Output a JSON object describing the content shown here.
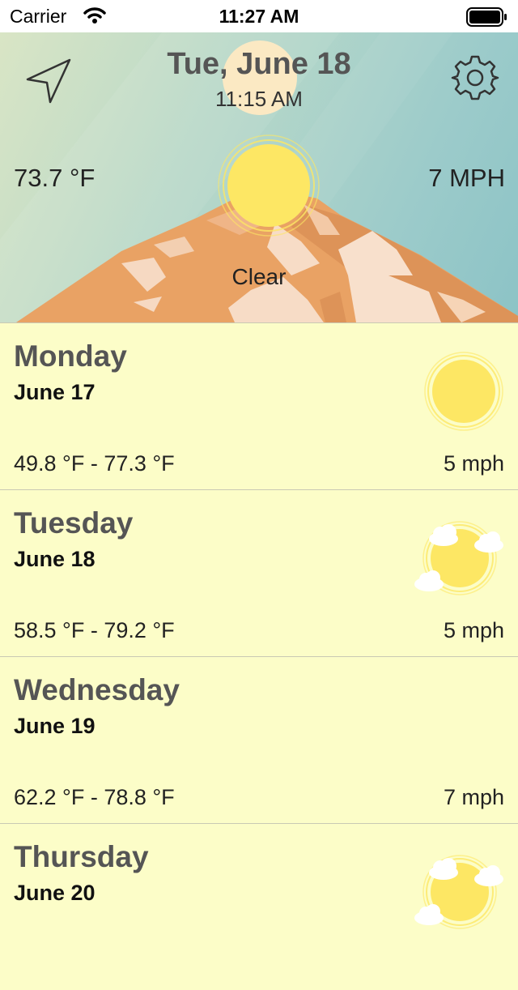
{
  "status_bar": {
    "carrier": "Carrier",
    "time": "11:27 AM"
  },
  "header": {
    "date": "Tue, June 18",
    "time": "11:15 AM",
    "temperature": "73.7 °F",
    "wind": "7 MPH",
    "condition": "Clear",
    "icons": {
      "left": "location-arrow-icon",
      "right": "gear-icon",
      "weather": "sun-icon"
    }
  },
  "forecast": [
    {
      "day": "Monday",
      "date": "June 17",
      "temp_range": "49.8 °F - 77.3 °F",
      "wind": "5 mph",
      "icon": "sun-icon"
    },
    {
      "day": "Tuesday",
      "date": "June 18",
      "temp_range": "58.5 °F - 79.2 °F",
      "wind": "5 mph",
      "icon": "sun-cloud-icon"
    },
    {
      "day": "Wednesday",
      "date": "June 19",
      "temp_range": "62.2 °F - 78.8 °F",
      "wind": "7 mph",
      "icon": ""
    },
    {
      "day": "Thursday",
      "date": "June 20",
      "temp_range": "",
      "wind": "",
      "icon": "sun-cloud-icon"
    }
  ],
  "colors": {
    "list_background": "#fcfdc8",
    "sun": "#fde764",
    "mountain": "#e9a264",
    "title_text": "#555555"
  }
}
